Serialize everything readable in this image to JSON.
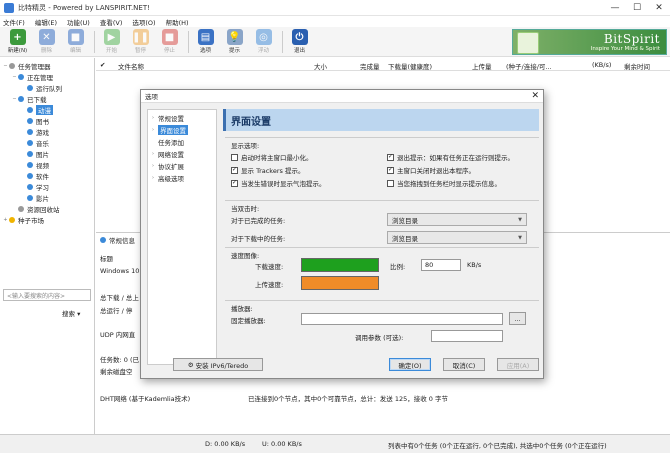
{
  "window": {
    "title": "比特精灵 - Powered by LANSPIRIT.NET!",
    "min": "—",
    "max": "☐",
    "close": "✕"
  },
  "menu": [
    "文件(F)",
    "编辑(E)",
    "功能(U)",
    "查看(V)",
    "选项(O)",
    "帮助(H)"
  ],
  "toolbar": [
    {
      "label": "新建(N)",
      "icon": "new-task-icon",
      "color": "#3c9a3c",
      "glyph": "+",
      "disabled": false
    },
    {
      "label": "删除",
      "icon": "delete-icon",
      "color": "#3b72c4",
      "glyph": "✕",
      "disabled": true
    },
    {
      "label": "编辑",
      "icon": "edit-icon",
      "color": "#3b72c4",
      "glyph": "■",
      "disabled": true
    },
    {
      "label": "开始",
      "icon": "start-icon",
      "color": "#5cb85c",
      "glyph": "▶",
      "disabled": true
    },
    {
      "label": "暂停",
      "icon": "pause-icon",
      "color": "#f0ad4e",
      "glyph": "❚❚",
      "disabled": true
    },
    {
      "label": "停止",
      "icon": "stop-icon",
      "color": "#d9534f",
      "glyph": "■",
      "disabled": true
    },
    {
      "label": "选项",
      "icon": "options-icon",
      "color": "#3b72c4",
      "glyph": "▤",
      "disabled": false
    },
    {
      "label": "提示",
      "icon": "tips-icon",
      "color": "#8aa5c8",
      "glyph": "💡",
      "disabled": false
    },
    {
      "label": "浮动",
      "icon": "float-icon",
      "color": "#4a90d9",
      "glyph": "◎",
      "disabled": true
    },
    {
      "label": "退出",
      "icon": "exit-icon",
      "color": "#2a5fb0",
      "glyph": "⏻",
      "disabled": false
    }
  ],
  "brand": {
    "name": "BitSpirit",
    "slogan": "Inspire Your Mind & Spirit"
  },
  "sidebar": {
    "items": [
      {
        "label": "任务管理器",
        "level": 0,
        "dot": "gray",
        "tw": "−"
      },
      {
        "label": "正在管理",
        "level": 1,
        "dot": "blue",
        "tw": "−"
      },
      {
        "label": "运行队列",
        "level": 2,
        "dot": "blue",
        "tw": ""
      },
      {
        "label": "已下载",
        "level": 1,
        "dot": "blue",
        "tw": "−"
      },
      {
        "label": "动漫",
        "level": 2,
        "dot": "blue",
        "tw": "",
        "selected": true
      },
      {
        "label": "图书",
        "level": 2,
        "dot": "blue",
        "tw": ""
      },
      {
        "label": "游戏",
        "level": 2,
        "dot": "blue",
        "tw": ""
      },
      {
        "label": "音乐",
        "level": 2,
        "dot": "blue",
        "tw": ""
      },
      {
        "label": "图片",
        "level": 2,
        "dot": "blue",
        "tw": ""
      },
      {
        "label": "视频",
        "level": 2,
        "dot": "blue",
        "tw": ""
      },
      {
        "label": "软件",
        "level": 2,
        "dot": "blue",
        "tw": ""
      },
      {
        "label": "学习",
        "level": 2,
        "dot": "blue",
        "tw": ""
      },
      {
        "label": "影片",
        "level": 2,
        "dot": "blue",
        "tw": ""
      },
      {
        "label": "资源回收站",
        "level": 1,
        "dot": "gray",
        "tw": ""
      },
      {
        "label": "种子市场",
        "level": 0,
        "dot": "yellow",
        "tw": "+"
      }
    ],
    "search_placeholder": "<输入要搜索的内容>",
    "search_button": "搜索 ▾"
  },
  "list_columns": [
    "文件名称",
    "大小",
    "完成量",
    "下载量(健康度)",
    "上传量",
    "(种子/连接/可...",
    "(KB/s)",
    "剩余时间"
  ],
  "bottom": {
    "tab": "常规信息",
    "lines": [
      "标题",
      "Windows 10",
      "总下载 / 总上",
      "总运行 / 停",
      "UDP 内网直",
      "任务数: 0 (已",
      "剩余磁盘空",
      "DHT网络 (基于Kademlia技术)"
    ],
    "dht_status": "已连接到0个节点，其中0个可靠节点，总计：发送 125，接收 0 字节"
  },
  "status": {
    "down": "D: 0.00 KB/s",
    "up": "U: 0.00 KB/s",
    "right": "列表中有0个任务 (0个正在运行, 0个已完成), 共选中0个任务 (0个正在运行)"
  },
  "dialog": {
    "title": "选项",
    "close": "✕",
    "nav": [
      {
        "label": "常规设置",
        "arrow": "›"
      },
      {
        "label": "界面设置",
        "arrow": "›",
        "active": true
      },
      {
        "label": "任务添加",
        "arrow": ""
      },
      {
        "label": "网络设置",
        "arrow": "›"
      },
      {
        "label": "协议扩展",
        "arrow": "›"
      },
      {
        "label": "高级选项",
        "arrow": "›"
      }
    ],
    "heading": "界面设置",
    "display_options": {
      "label": "显示选项:",
      "items": [
        {
          "label": "启动时将主窗口最小化。",
          "checked": false
        },
        {
          "label": "退出提示：如果有任务正在运行则提示。",
          "checked": true
        },
        {
          "label": "显示 Trackers 提示。",
          "checked": true
        },
        {
          "label": "主窗口关闭时退出本程序。",
          "checked": true
        },
        {
          "label": "当发生错误时显示气泡提示。",
          "checked": true
        },
        {
          "label": "当您拖拽到任务栏时显示提示信息。",
          "checked": false
        }
      ]
    },
    "dblclick": {
      "label": "当双击时:",
      "rows": [
        {
          "label": "对于已完成的任务:",
          "value": "浏览目录"
        },
        {
          "label": "对于下载中的任务:",
          "value": "浏览目录"
        }
      ]
    },
    "speed": {
      "label": "速度图像:",
      "down_label": "下载速度:",
      "up_label": "上传速度:",
      "down_color": "#1ea01e",
      "up_color": "#f08c28",
      "scale_label": "比例:",
      "scale_value": "80",
      "unit": "KB/s"
    },
    "player": {
      "label": "播放器:",
      "fixed_label": "固定播放器:",
      "browse": "...",
      "args_label": "调用参数 (可选):"
    },
    "buttons": {
      "ipv6": "安装 IPv6/Teredo",
      "ok": "确定(O)",
      "cancel": "取消(C)",
      "apply": "应用(A)"
    }
  }
}
